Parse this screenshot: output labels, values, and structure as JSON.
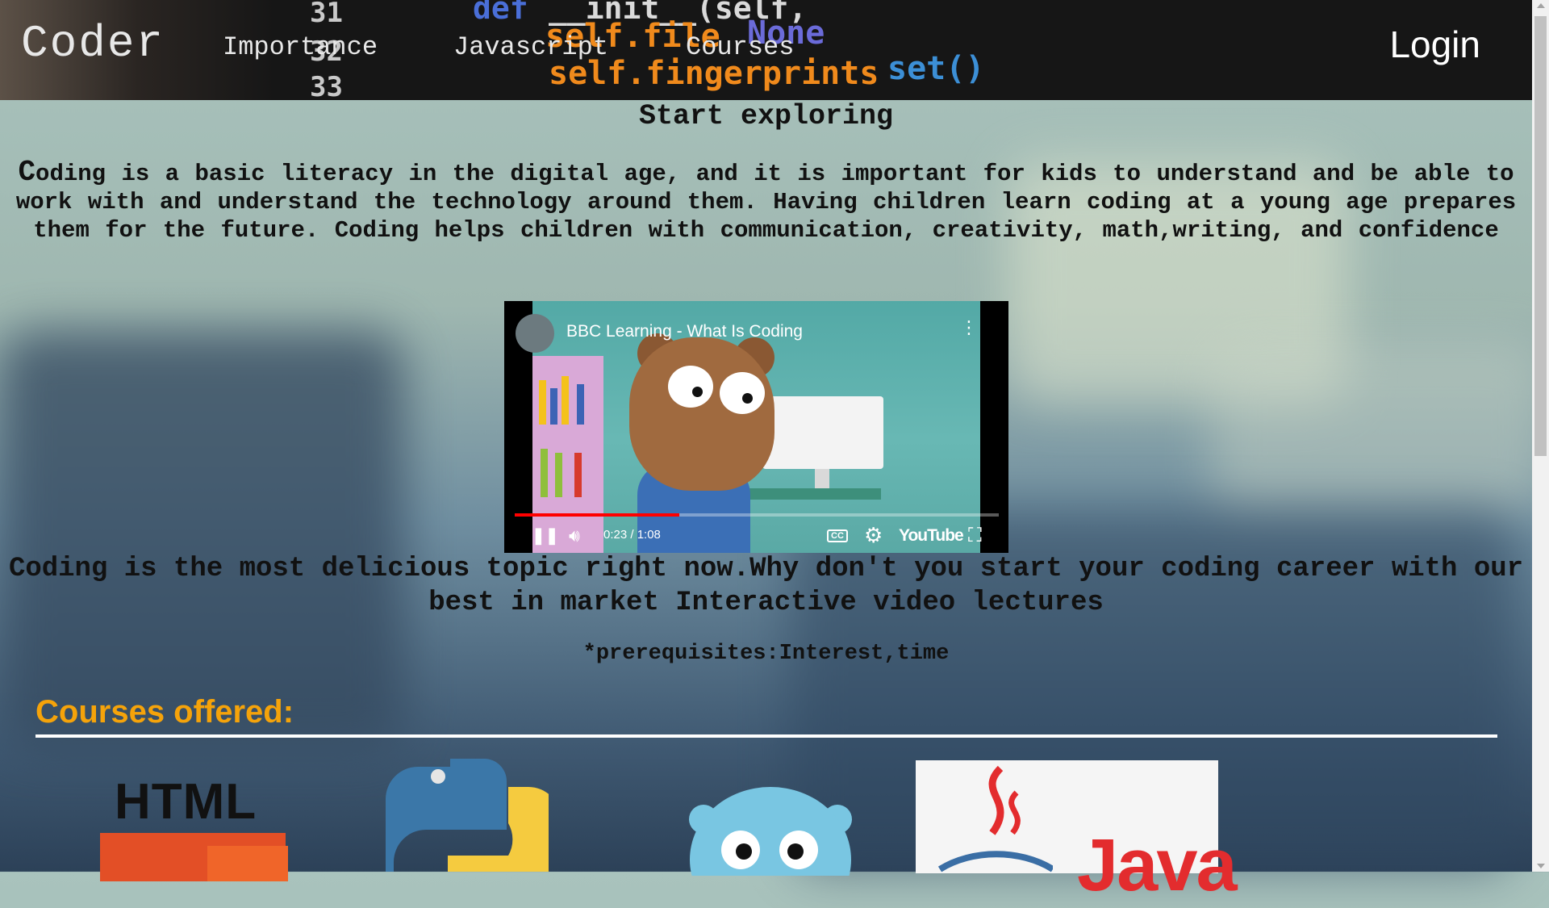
{
  "header": {
    "brand": "Coder",
    "nav": [
      {
        "label": "Importance"
      },
      {
        "label": "Javascript"
      },
      {
        "label": "Courses"
      }
    ],
    "login_label": "Login",
    "code_backdrop": [
      "def",
      "__init__(self,",
      "self.file",
      "None",
      "self.fingerprints",
      "set()",
      "31",
      "32",
      "33"
    ]
  },
  "main": {
    "title": "Start exploring",
    "intro_first_letter": "C",
    "intro_rest": "oding is a basic literacy in the digital age, and it is important for kids to understand and be able to work with and understand the technology around them. Having children learn coding at a young age prepares them for the future. Coding helps children with communication, creativity, math,writing, and confidence",
    "promo": "Coding is the most delicious topic right now.Why don't you start your coding career with our best in market Interactive video lectures",
    "prerequisites": "*prerequisites:Interest,time",
    "courses_heading": "Courses offered:"
  },
  "video": {
    "title": "BBC Learning - What Is Coding",
    "time": "0:23 / 1:08",
    "progress_fraction": 0.34,
    "logo_text": "YouTube",
    "cc_label": "CC"
  },
  "courses": [
    {
      "name": "HTML",
      "logo_text": "HTML"
    },
    {
      "name": "Python"
    },
    {
      "name": "Go"
    },
    {
      "name": "Java",
      "logo_text": "Java"
    }
  ],
  "colors": {
    "accent": "#f5a30a",
    "header_bg": "#161616",
    "progress": "#ff0000"
  }
}
